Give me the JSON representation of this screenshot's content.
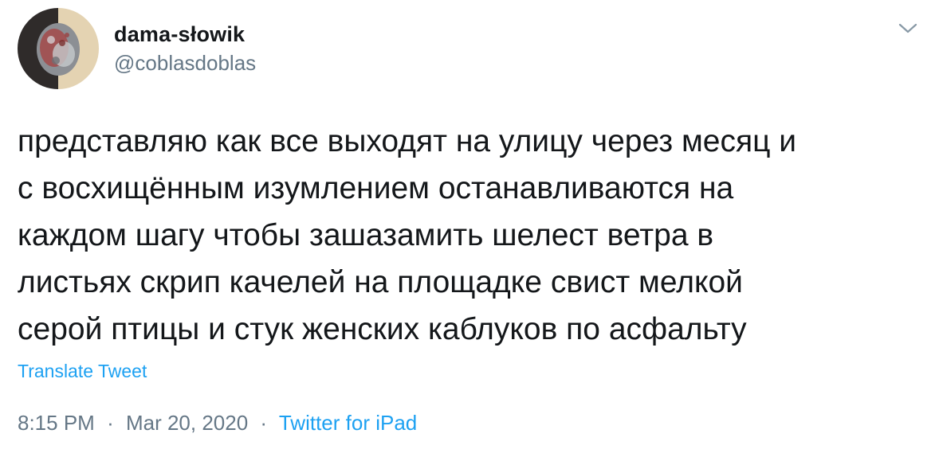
{
  "user": {
    "display_name": "dama-słowik",
    "handle": "@coblasdoblas"
  },
  "tweet": {
    "lines": [
      "представляю как все выходят на улицу через месяц и",
      "с восхищённым изумлением останавливаются на",
      "каждом шагу чтобы зашазамить шелест ветра в",
      "листьях скрип качелей на площадке свист мелкой",
      "серой птицы и стук женских каблуков по асфальту"
    ],
    "translate_label": "Translate Tweet"
  },
  "meta": {
    "time": "8:15 PM",
    "separator": "·",
    "date": "Mar 20, 2020",
    "source": "Twitter for iPad"
  },
  "colors": {
    "text": "#14171a",
    "secondary": "#657786",
    "link": "#1da1f2"
  },
  "icons": {
    "menu": "chevron-down-icon"
  }
}
